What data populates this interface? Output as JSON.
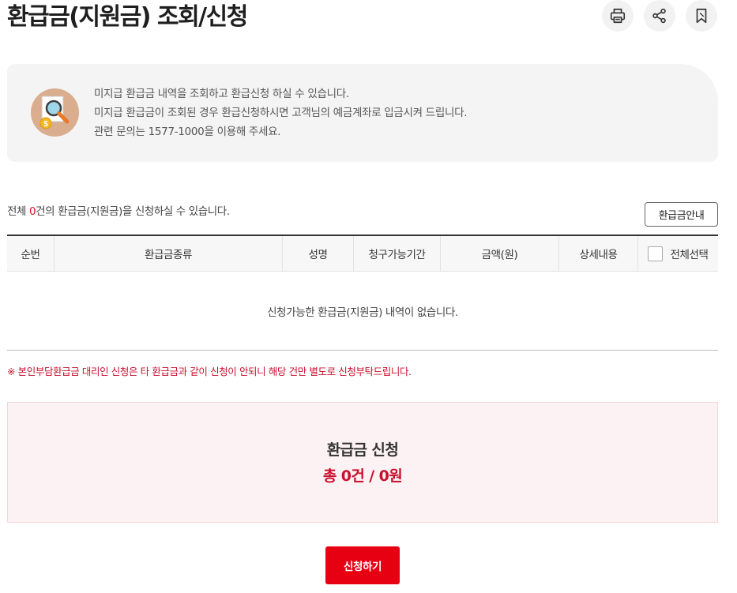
{
  "page": {
    "title": "환급금(지원금) 조회/신청"
  },
  "top_actions": [
    {
      "name": "print-button",
      "icon": "printer-icon"
    },
    {
      "name": "share-button",
      "icon": "share-icon"
    },
    {
      "name": "bookmark-button",
      "icon": "bookmark-icon"
    }
  ],
  "info": {
    "icon": "magnifier-coin-icon",
    "lines": [
      "미지급 환급금 내역을 조회하고 환급신청 하실 수 있습니다.",
      "미지급 환급금이 조회된 경우 환급신청하시면 고객님의 예금계좌로 입금시켜 드립니다.",
      "관련 문의는 1577-1000을 이용해 주세요."
    ]
  },
  "summary_line": {
    "prefix": "전체 ",
    "count": "0",
    "suffix": "건의 환급금(지원금)을 신청하실 수 있습니다."
  },
  "guide_button": "환급금안내",
  "table": {
    "headers": [
      "순번",
      "환급금종류",
      "성명",
      "청구가능기간",
      "금액(원)",
      "상세내용",
      "전체선택"
    ],
    "empty_message": "신청가능한 환급금(지원금) 내역이 없습니다."
  },
  "notice": "※ 본인부담환급금 대리인 신청은 타 환급금과 같이 신청이 안되니 해당 건만 별도로 신청부탁드립니다.",
  "summary_box": {
    "title": "환급금 신청",
    "total": "총 0건 / 0원"
  },
  "apply_button": "신청하기",
  "colors": {
    "accent": "#e60012",
    "alert_text": "#c8102e",
    "summary_bg": "#fdf2f3"
  }
}
